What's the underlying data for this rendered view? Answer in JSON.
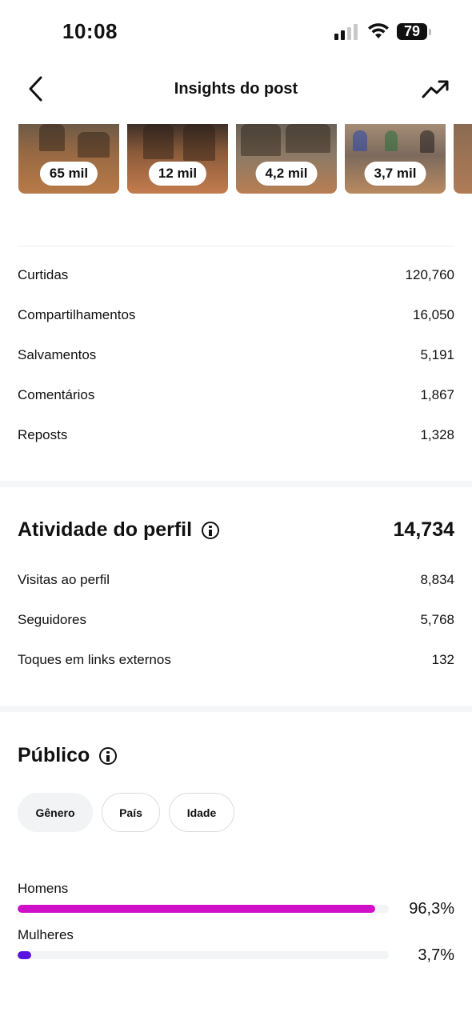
{
  "status_bar": {
    "time": "10:08",
    "battery": "79"
  },
  "header": {
    "title": "Insights do post"
  },
  "thumbnails": [
    {
      "label": "65 mil"
    },
    {
      "label": "12 mil"
    },
    {
      "label": "4,2 mil"
    },
    {
      "label": "3,7 mil"
    }
  ],
  "interactions": [
    {
      "label": "Curtidas",
      "value": "120,760"
    },
    {
      "label": "Compartilhamentos",
      "value": "16,050"
    },
    {
      "label": "Salvamentos",
      "value": "5,191"
    },
    {
      "label": "Comentários",
      "value": "1,867"
    },
    {
      "label": "Reposts",
      "value": "1,328"
    }
  ],
  "profile_activity": {
    "title": "Atividade do perfil",
    "total": "14,734",
    "rows": [
      {
        "label": "Visitas ao perfil",
        "value": "8,834"
      },
      {
        "label": "Seguidores",
        "value": "5,768"
      },
      {
        "label": "Toques em links externos",
        "value": "132"
      }
    ]
  },
  "audience": {
    "title": "Público",
    "tabs": [
      "Gênero",
      "País",
      "Idade"
    ],
    "active_tab": "Gênero",
    "bars": [
      {
        "label": "Homens",
        "value_text": "96,3%",
        "fraction": 0.963,
        "color": "#d10fc9"
      },
      {
        "label": "Mulheres",
        "value_text": "3,7%",
        "fraction": 0.037,
        "color": "#5a12e0"
      }
    ]
  }
}
